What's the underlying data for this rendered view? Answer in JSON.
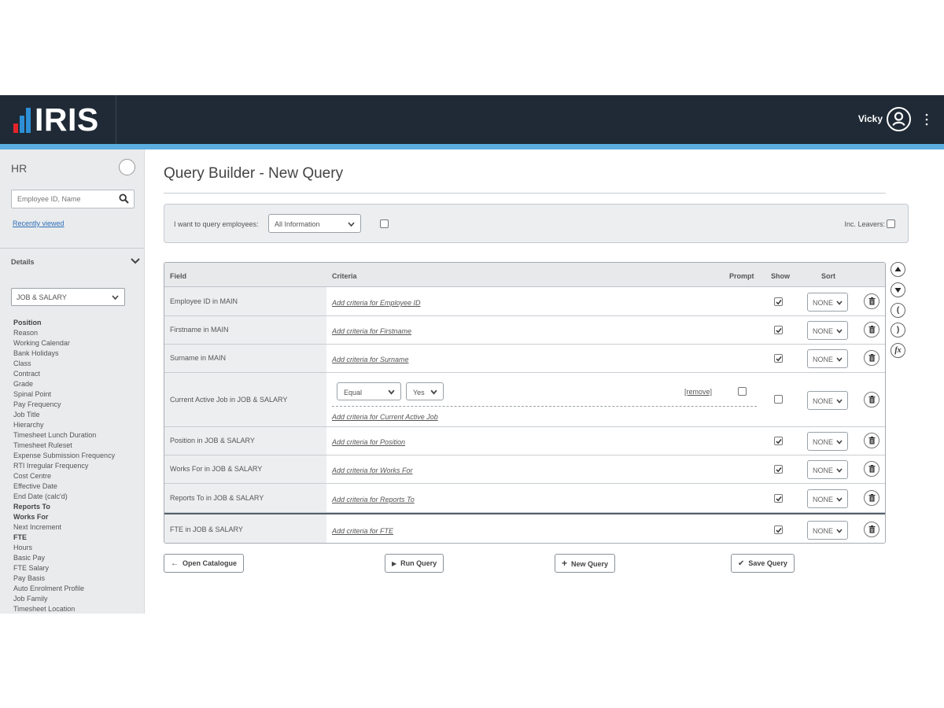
{
  "header": {
    "logo_text": "IRIS",
    "logo_bar_colors": [
      "#e2242b",
      "#2d8fd5",
      "#2d8fd5"
    ],
    "user_name": "Vicky"
  },
  "sidebar": {
    "title": "HR",
    "search_placeholder": "Employee ID, Name",
    "recently_viewed": "Recently viewed",
    "details_label": "Details",
    "category_select": "JOB & SALARY",
    "fields": [
      {
        "label": "Position",
        "bold": true
      },
      {
        "label": "Reason",
        "bold": false
      },
      {
        "label": "Working Calendar",
        "bold": false
      },
      {
        "label": "Bank Holidays",
        "bold": false
      },
      {
        "label": "Class",
        "bold": false
      },
      {
        "label": "Contract",
        "bold": false
      },
      {
        "label": "Grade",
        "bold": false
      },
      {
        "label": "Spinal Point",
        "bold": false
      },
      {
        "label": "Pay Frequency",
        "bold": false
      },
      {
        "label": "Job Title",
        "bold": false
      },
      {
        "label": "Hierarchy",
        "bold": false
      },
      {
        "label": "Timesheet Lunch Duration",
        "bold": false
      },
      {
        "label": "Timesheet Ruleset",
        "bold": false
      },
      {
        "label": "Expense Submission Frequency",
        "bold": false
      },
      {
        "label": "RTI Irregular Frequency",
        "bold": false
      },
      {
        "label": "Cost Centre",
        "bold": false
      },
      {
        "label": "Effective Date",
        "bold": false
      },
      {
        "label": "End Date (calc'd)",
        "bold": false
      },
      {
        "label": "Reports To",
        "bold": true
      },
      {
        "label": "Works For",
        "bold": true
      },
      {
        "label": "Next Increment",
        "bold": false
      },
      {
        "label": "FTE",
        "bold": true
      },
      {
        "label": "Hours",
        "bold": false
      },
      {
        "label": "Basic Pay",
        "bold": false
      },
      {
        "label": "FTE Salary",
        "bold": false
      },
      {
        "label": "Pay Basis",
        "bold": false
      },
      {
        "label": "Auto Enrolment Profile",
        "bold": false
      },
      {
        "label": "Job Family",
        "bold": false
      },
      {
        "label": "Timesheet Location",
        "bold": false
      }
    ]
  },
  "main": {
    "title": "Query Builder - New Query",
    "query_bar": {
      "label": "I want to query employees:",
      "select_value": "All Information",
      "inc_leavers": "Inc. Leavers:"
    },
    "grid": {
      "headers": {
        "field": "Field",
        "criteria": "Criteria",
        "prompt": "Prompt",
        "show": "Show",
        "sort": "Sort"
      },
      "rows": [
        {
          "field": "Employee ID in MAIN",
          "criteria": "Add criteria for Employee ID",
          "show": true,
          "sort": "NONE"
        },
        {
          "field": "Firstname in MAIN",
          "criteria": "Add criteria for Firstname",
          "show": true,
          "sort": "NONE"
        },
        {
          "field": "Surname in MAIN",
          "criteria": "Add criteria for Surname",
          "show": true,
          "sort": "NONE"
        },
        {
          "field": "Current Active Job in JOB & SALARY",
          "criteria": "Add criteria for Current Active Job",
          "show": false,
          "sort": "NONE",
          "operator": "Equal",
          "value": "Yes",
          "remove": "[remove]"
        },
        {
          "field": "Position in JOB & SALARY",
          "criteria": "Add criteria for Position",
          "show": true,
          "sort": "NONE"
        },
        {
          "field": "Works For in JOB & SALARY",
          "criteria": "Add criteria for Works For",
          "show": true,
          "sort": "NONE"
        },
        {
          "field": "Reports To in JOB & SALARY",
          "criteria": "Add criteria for Reports To",
          "show": true,
          "sort": "NONE"
        },
        {
          "field": "FTE in JOB & SALARY",
          "criteria": "Add criteria for FTE",
          "show": true,
          "sort": "NONE"
        }
      ]
    },
    "side_controls": [
      "move-up",
      "move-down",
      "open-bracket",
      "close-bracket",
      "function"
    ],
    "side_labels": {
      "open": "(",
      "close": ")",
      "fx": "fx"
    },
    "buttons": {
      "open_catalogue": "Open Catalogue",
      "run_query": "Run Query",
      "new_query": "New Query",
      "save_query": "Save Query"
    }
  }
}
